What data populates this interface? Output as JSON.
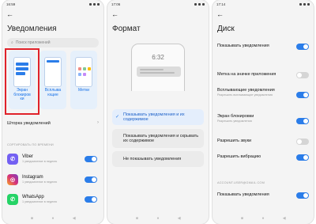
{
  "phone1": {
    "status_time": "16:59",
    "title": "Уведомления",
    "search_placeholder": "Поиск приложений",
    "styles": [
      {
        "label": "Экран\nблокиров\nки"
      },
      {
        "label": "Всплыва\nющие"
      },
      {
        "label": "Метки"
      }
    ],
    "shade_label": "Шторка уведомлений",
    "section_caption": "СОРТИРОВАТЬ ПО ВРЕМЕНИ",
    "apps": [
      {
        "name": "Viber",
        "sub": "1 уведомление в неделю",
        "icon": "viber-icon",
        "color": "#7360f2",
        "glyph": "✆",
        "on": true
      },
      {
        "name": "Instagram",
        "sub": "1 уведомление в неделю",
        "icon": "instagram-icon",
        "color": "#d6307a",
        "glyph": "◎",
        "on": true
      },
      {
        "name": "WhatsApp",
        "sub": "1 уведомление в неделю",
        "icon": "whatsapp-icon",
        "color": "#25d366",
        "glyph": "✆",
        "on": true
      }
    ]
  },
  "phone2": {
    "status_time": "17:06",
    "title": "Формат",
    "preview_time": "6:32",
    "options": [
      {
        "label": "Показывать уведомления и их содержимое",
        "selected": true
      },
      {
        "label": "Показывать уведомления и скрывать их содержимое",
        "selected": false
      },
      {
        "label": "Не показывать уведомления",
        "selected": false
      }
    ]
  },
  "phone3": {
    "status_time": "17:14",
    "title": "Диск",
    "settings": [
      {
        "label": "Показывать уведомления",
        "sub": "",
        "on": true
      },
      {
        "label": "Метка на значке приложения",
        "sub": "",
        "on": false
      },
      {
        "label": "Всплывающие уведомления",
        "sub": "Разрешить всплывающие уведомления",
        "on": true
      },
      {
        "label": "Экран блокировки",
        "sub": "Разрешить уведомления",
        "on": true
      },
      {
        "label": "Разрешить звуки",
        "sub": "",
        "on": false
      },
      {
        "label": "Разрешить вибрацию",
        "sub": "",
        "on": true
      }
    ],
    "account_caption": "ACCOUNT.USER@GMAIL.COM",
    "account_setting": {
      "label": "Показывать уведомления",
      "on": true
    }
  },
  "colors": {
    "accent": "#2b7de9",
    "highlight_box": "#e0222a",
    "toggle_off": "#d5d5d5"
  }
}
